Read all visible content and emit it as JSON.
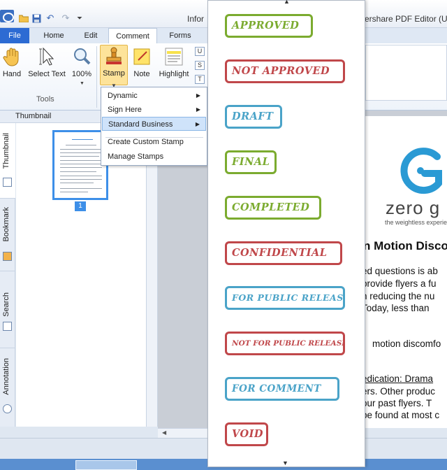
{
  "window": {
    "title_left": "Infor",
    "title_right": "ershare PDF Editor (U"
  },
  "ribbon": {
    "tabs": [
      {
        "label": "File"
      },
      {
        "label": "Home"
      },
      {
        "label": "Edit"
      },
      {
        "label": "Comment"
      },
      {
        "label": "Forms"
      }
    ],
    "tools": {
      "hand": "Hand",
      "select_text": "Select Text",
      "zoom": "100%",
      "stamp": "Stamp",
      "note": "Note",
      "highlight": "Highlight"
    },
    "group_label": "Tools"
  },
  "stamp_menu": {
    "items": [
      {
        "label": "Dynamic",
        "submenu": true
      },
      {
        "label": "Sign Here",
        "submenu": true
      },
      {
        "label": "Standard Business",
        "submenu": true,
        "selected": true
      },
      {
        "label": "Create Custom Stamp"
      },
      {
        "label": "Manage Stamps"
      }
    ]
  },
  "left_panel": {
    "header": "Thumbnail",
    "side_tabs": [
      {
        "label": "Thumbnail"
      },
      {
        "label": "Bookmark"
      },
      {
        "label": "Search"
      },
      {
        "label": "Annotation"
      }
    ],
    "page_number": "1"
  },
  "stamps": [
    {
      "label": "APPROVED",
      "color": "#7bab2f"
    },
    {
      "label": "NOT APPROVED",
      "color": "#c0474a"
    },
    {
      "label": "DRAFT",
      "color": "#4aa3c8"
    },
    {
      "label": "FINAL",
      "color": "#7bab2f"
    },
    {
      "label": "COMPLETED",
      "color": "#7bab2f"
    },
    {
      "label": "CONFIDENTIAL",
      "color": "#c0474a"
    },
    {
      "label": "FOR PUBLIC RELEASE",
      "color": "#4aa3c8"
    },
    {
      "label": "NOT FOR PUBLIC RELEASE",
      "color": "#c0474a"
    },
    {
      "label": "FOR COMMENT",
      "color": "#4aa3c8"
    },
    {
      "label": "VOID",
      "color": "#c0474a"
    }
  ],
  "document": {
    "logo_text": "zero g",
    "logo_tagline": "the weightless experien",
    "heading": "n Motion Disco",
    "lines": [
      "ed questions is ab",
      "provide flyers a fu",
      "n reducing the nu",
      "Today, less than",
      "motion discomfo",
      "edication: Drama",
      "ers.  Other produc",
      "our past flyers. T",
      "be found at most c"
    ]
  }
}
